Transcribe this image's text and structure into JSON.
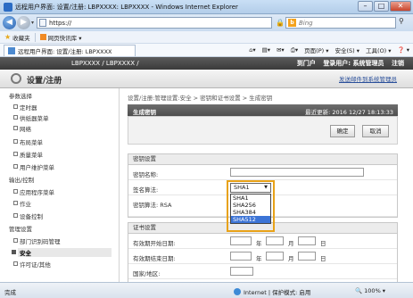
{
  "window": {
    "title": "远程用户界面: 设置/注册: LBPXXXX: LBPXXXX - Windows Internet Explorer",
    "buttons": {
      "minimize": "–",
      "maximize": "□",
      "close": "✕"
    }
  },
  "browser": {
    "url": "https://",
    "search_placeholder": "Bing",
    "favorites_label": "收藏夹",
    "favorites_item": "网页快讯库 ▾",
    "tab_title": "远程用户界面: 设置/注册: LBPXXXX",
    "commands": {
      "page": "页面(P) ▾",
      "safety": "安全(S) ▾",
      "tools": "工具(O) ▾",
      "help": "❓ ▾"
    },
    "status_done": "完成",
    "zone": "Internet | 保护模式: 启用",
    "zoom": "🔍 100% ▾"
  },
  "header": {
    "model": "LBPXXXX / LBPXXXX /",
    "to_portal": "到门户",
    "login_user": "登录用户: 系统管理员",
    "logout": "注销"
  },
  "subheader": {
    "title": "设置/注册",
    "admin_mail": "发送邮件到系统管理员"
  },
  "sidebar": {
    "sections": [
      {
        "label": "参数选择"
      },
      {
        "label": "输出/控制"
      },
      {
        "label": "管理设置"
      }
    ],
    "items": [
      {
        "label": "定时器"
      },
      {
        "label": "供纸器菜单"
      },
      {
        "label": "网络"
      },
      {
        "label": "布局菜单"
      },
      {
        "label": "质量菜单"
      },
      {
        "label": "用户维护菜单"
      },
      {
        "label": "应用程序菜单"
      },
      {
        "label": "作业"
      },
      {
        "label": "设备控制"
      },
      {
        "label": "部门识别码管理"
      },
      {
        "label": "安全"
      },
      {
        "label": "许可证/其他"
      }
    ]
  },
  "main": {
    "breadcrumb": "设置/注册:管理设置:安全 > 密钥和证书设置 > 生成密钥",
    "section_title": "生成密钥",
    "last_updated": "最近更新: 2016 12/27 18:13:33",
    "ok_button": "确定",
    "cancel_button": "取消",
    "key_settings": {
      "header": "密钥设置",
      "key_name_label": "密钥名称:",
      "sig_algorithm_label": "签名算法:",
      "sig_selected": "SHA1",
      "sig_options": [
        "SHA1",
        "SHA256",
        "SHA384",
        "SHA512"
      ],
      "sig_highlighted": "SHA512",
      "key_algorithm_label": "密钥算法: RSA"
    },
    "cert_settings": {
      "header": "证书设置",
      "start_label": "有效期开始日期:",
      "end_label": "有效期结束日期:",
      "country_label": "国家/地区:",
      "unit_year": "年",
      "unit_month": "月",
      "unit_day": "日"
    }
  }
}
